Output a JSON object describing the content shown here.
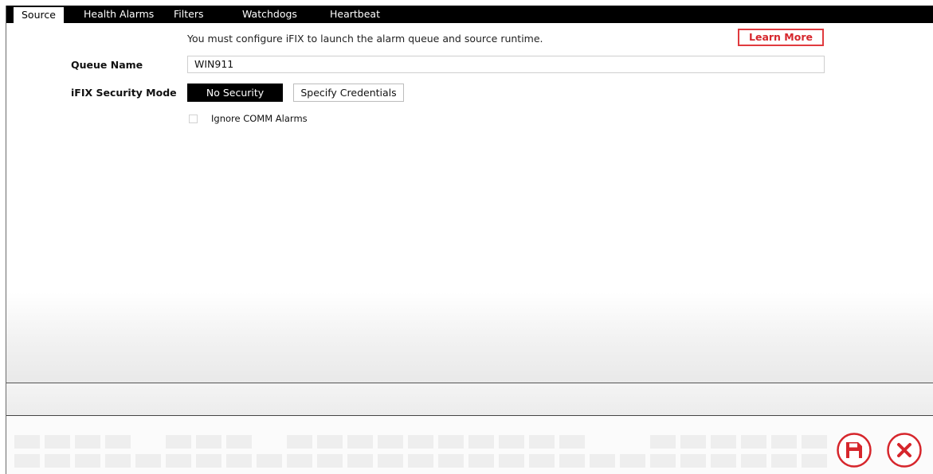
{
  "tabs": [
    {
      "label": "Source",
      "active": true
    },
    {
      "label": "Health Alarms",
      "active": false
    },
    {
      "label": "Filters",
      "active": false
    },
    {
      "label": "Watchdogs",
      "active": false
    },
    {
      "label": "Heartbeat",
      "active": false
    }
  ],
  "source": {
    "message": "You must configure iFIX to launch the alarm queue and source runtime.",
    "learn_more": "Learn More",
    "queue_name_label": "Queue Name",
    "queue_name_value": "WIN911",
    "security_mode_label": "iFIX Security Mode",
    "security_options": [
      {
        "label": "No Security",
        "selected": true
      },
      {
        "label": "Specify Credentials",
        "selected": false
      }
    ],
    "ignore_comm_alarms_label": "Ignore COMM Alarms",
    "ignore_comm_alarms_checked": false
  },
  "footer": {
    "save_icon": "save-icon",
    "close_icon": "close-icon"
  },
  "colors": {
    "accent": "#d6262c",
    "tabbar": "#000000"
  }
}
